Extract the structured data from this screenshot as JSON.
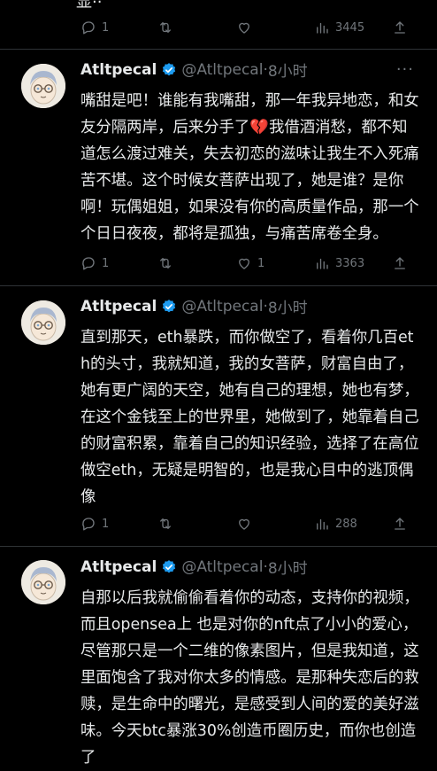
{
  "top": {
    "fragment": "显··",
    "actions": {
      "reply": "1",
      "retweet": "",
      "like": "",
      "views": "3445"
    }
  },
  "tweets": [
    {
      "name": "Atltpecal",
      "handle": "@Atltpecal",
      "time": "8小时",
      "text_before": "嘴甜是吧！谁能有我嘴甜，那一年我异地恋，和女友分隔两岸，后来分手了",
      "emoji": "💔",
      "text_after": "我借酒消愁，都不知道怎么渡过难关，失去初恋的滋味让我生不入死痛苦不堪。这个时候女菩萨出现了，她是谁？是你啊！玩偶姐姐，如果没有你的高质量作品，那一个个日日夜夜，都将是孤独，与痛苦席卷全身。",
      "actions": {
        "reply": "1",
        "retweet": "",
        "like": "1",
        "views": "3363"
      }
    },
    {
      "name": "Atltpecal",
      "handle": "@Atltpecal",
      "time": "8小时",
      "text_before": "直到那天，eth暴跌，而你做空了，看着你几百eth的头寸，我就知道，我的女菩萨，财富自由了，她有更广阔的天空，她有自己的理想，她也有梦，在这个金钱至上的世界里，她做到了，她靠着自己的财富积累，靠着自己的知识经验，选择了在高位做空eth，无疑是明智的，也是我心目中的逃顶偶像",
      "emoji": "",
      "text_after": "",
      "actions": {
        "reply": "1",
        "retweet": "",
        "like": "",
        "views": "288"
      }
    },
    {
      "name": "Atltpecal",
      "handle": "@Atltpecal",
      "time": "8小时",
      "text_before": "自那以后我就偷偷看着你的动态，支持你的视频，而且opensea上 也是对你的nft点了小小的爱心，尽管那只是一个二维的像素图片，但是我知道，这里面饱含了我对你太多的情感。是那种失恋后的救赎，是生命中的曙光，是感受到人间的爱的美好滋味。今天btc暴涨30%创造币圈历史，而你也创造了",
      "emoji": "",
      "text_after": "",
      "actions": null
    }
  ]
}
